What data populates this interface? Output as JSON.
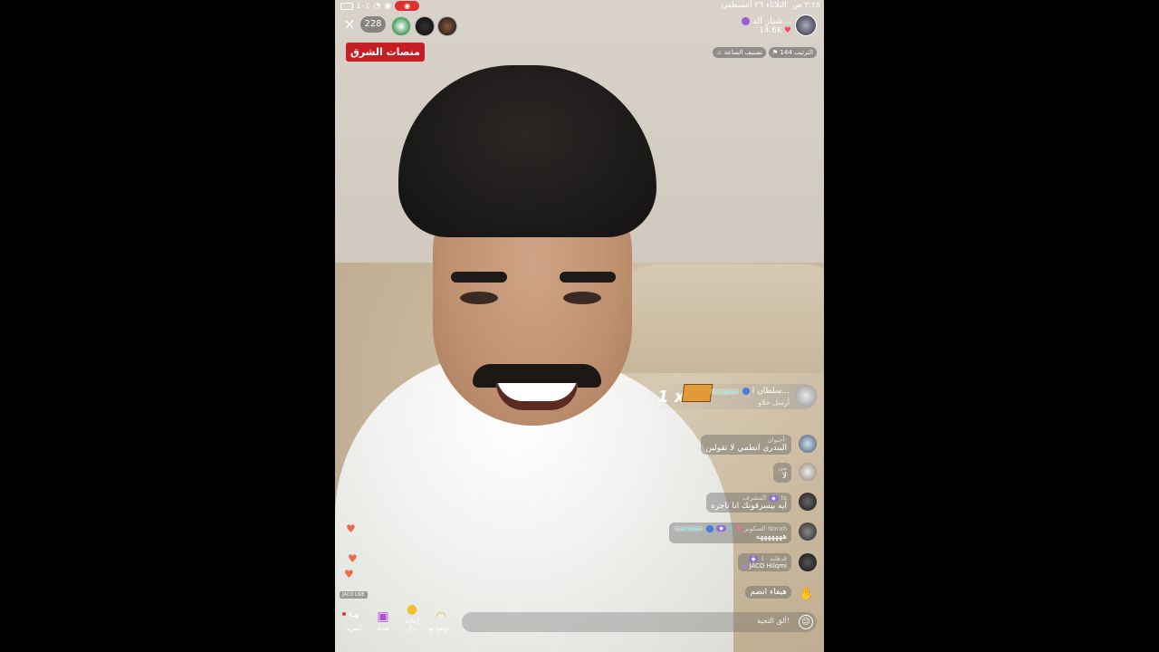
{
  "status_bar": {
    "time": "٣:٢٨ ص",
    "date": "الثلاثاء ٢٦ أغسطس",
    "battery": "٤٠٪"
  },
  "top": {
    "close_icon": "×",
    "viewer_count": "228",
    "host_name": "شنار الد...",
    "host_likes": "14.6K",
    "brand": "منصات الشرق",
    "rank_badge": "الترتيب 144",
    "hour_badge": "تصنيف الساعة"
  },
  "gift": {
    "sender": "سلطان ا...",
    "tag": "مشجع جديد",
    "text": "أرسل حلاو",
    "count": "1 x"
  },
  "comments": [
    {
      "user": "أجنوان-",
      "text": "البندري انطمي لا تقولين"
    },
    {
      "user": "مي",
      "text": "لا"
    },
    {
      "user": "lq",
      "tag": "المشرف",
      "text": "ايه بيسرقونك انا تاجره"
    },
    {
      "user": "السكوتر Norah",
      "tag": "مشجع جديد",
      "text": "هههههههه"
    },
    {
      "user": "قدهلنه ٤٠",
      "text": "",
      "extra": "JACO Hilqmi"
    }
  ],
  "last_comment": "هيفاء انضم",
  "jaco_tag": "JACO LIVE",
  "bottom": {
    "more_label": "المزيد",
    "gift_label": "هدية",
    "repost_label": "إعادة ال...",
    "mode_label": "وضع تع...",
    "input_placeholder": "ألق التحية!"
  }
}
